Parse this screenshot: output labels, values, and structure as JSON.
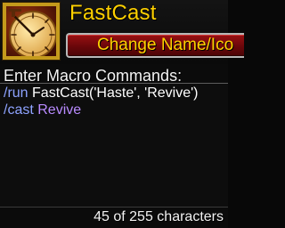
{
  "header": {
    "macro_name": "FastCast",
    "change_button_label": "Change Name/Ico",
    "icon_name": "clock-dial-icon"
  },
  "editor": {
    "label": "Enter Macro Commands:",
    "lines": [
      {
        "command": "/run",
        "text": " FastCast('Haste', 'Revive')"
      },
      {
        "command": "/cast",
        "text": " Revive"
      }
    ]
  },
  "footer": {
    "used": "45",
    "of_word": " of ",
    "max": "255",
    "unit": " characters"
  },
  "colors": {
    "title": "#ffd100",
    "button_bg": "#8a0c0e",
    "command": "#8ea3ff",
    "spell": "#b98bff",
    "icon_border": "#c49a1c"
  }
}
